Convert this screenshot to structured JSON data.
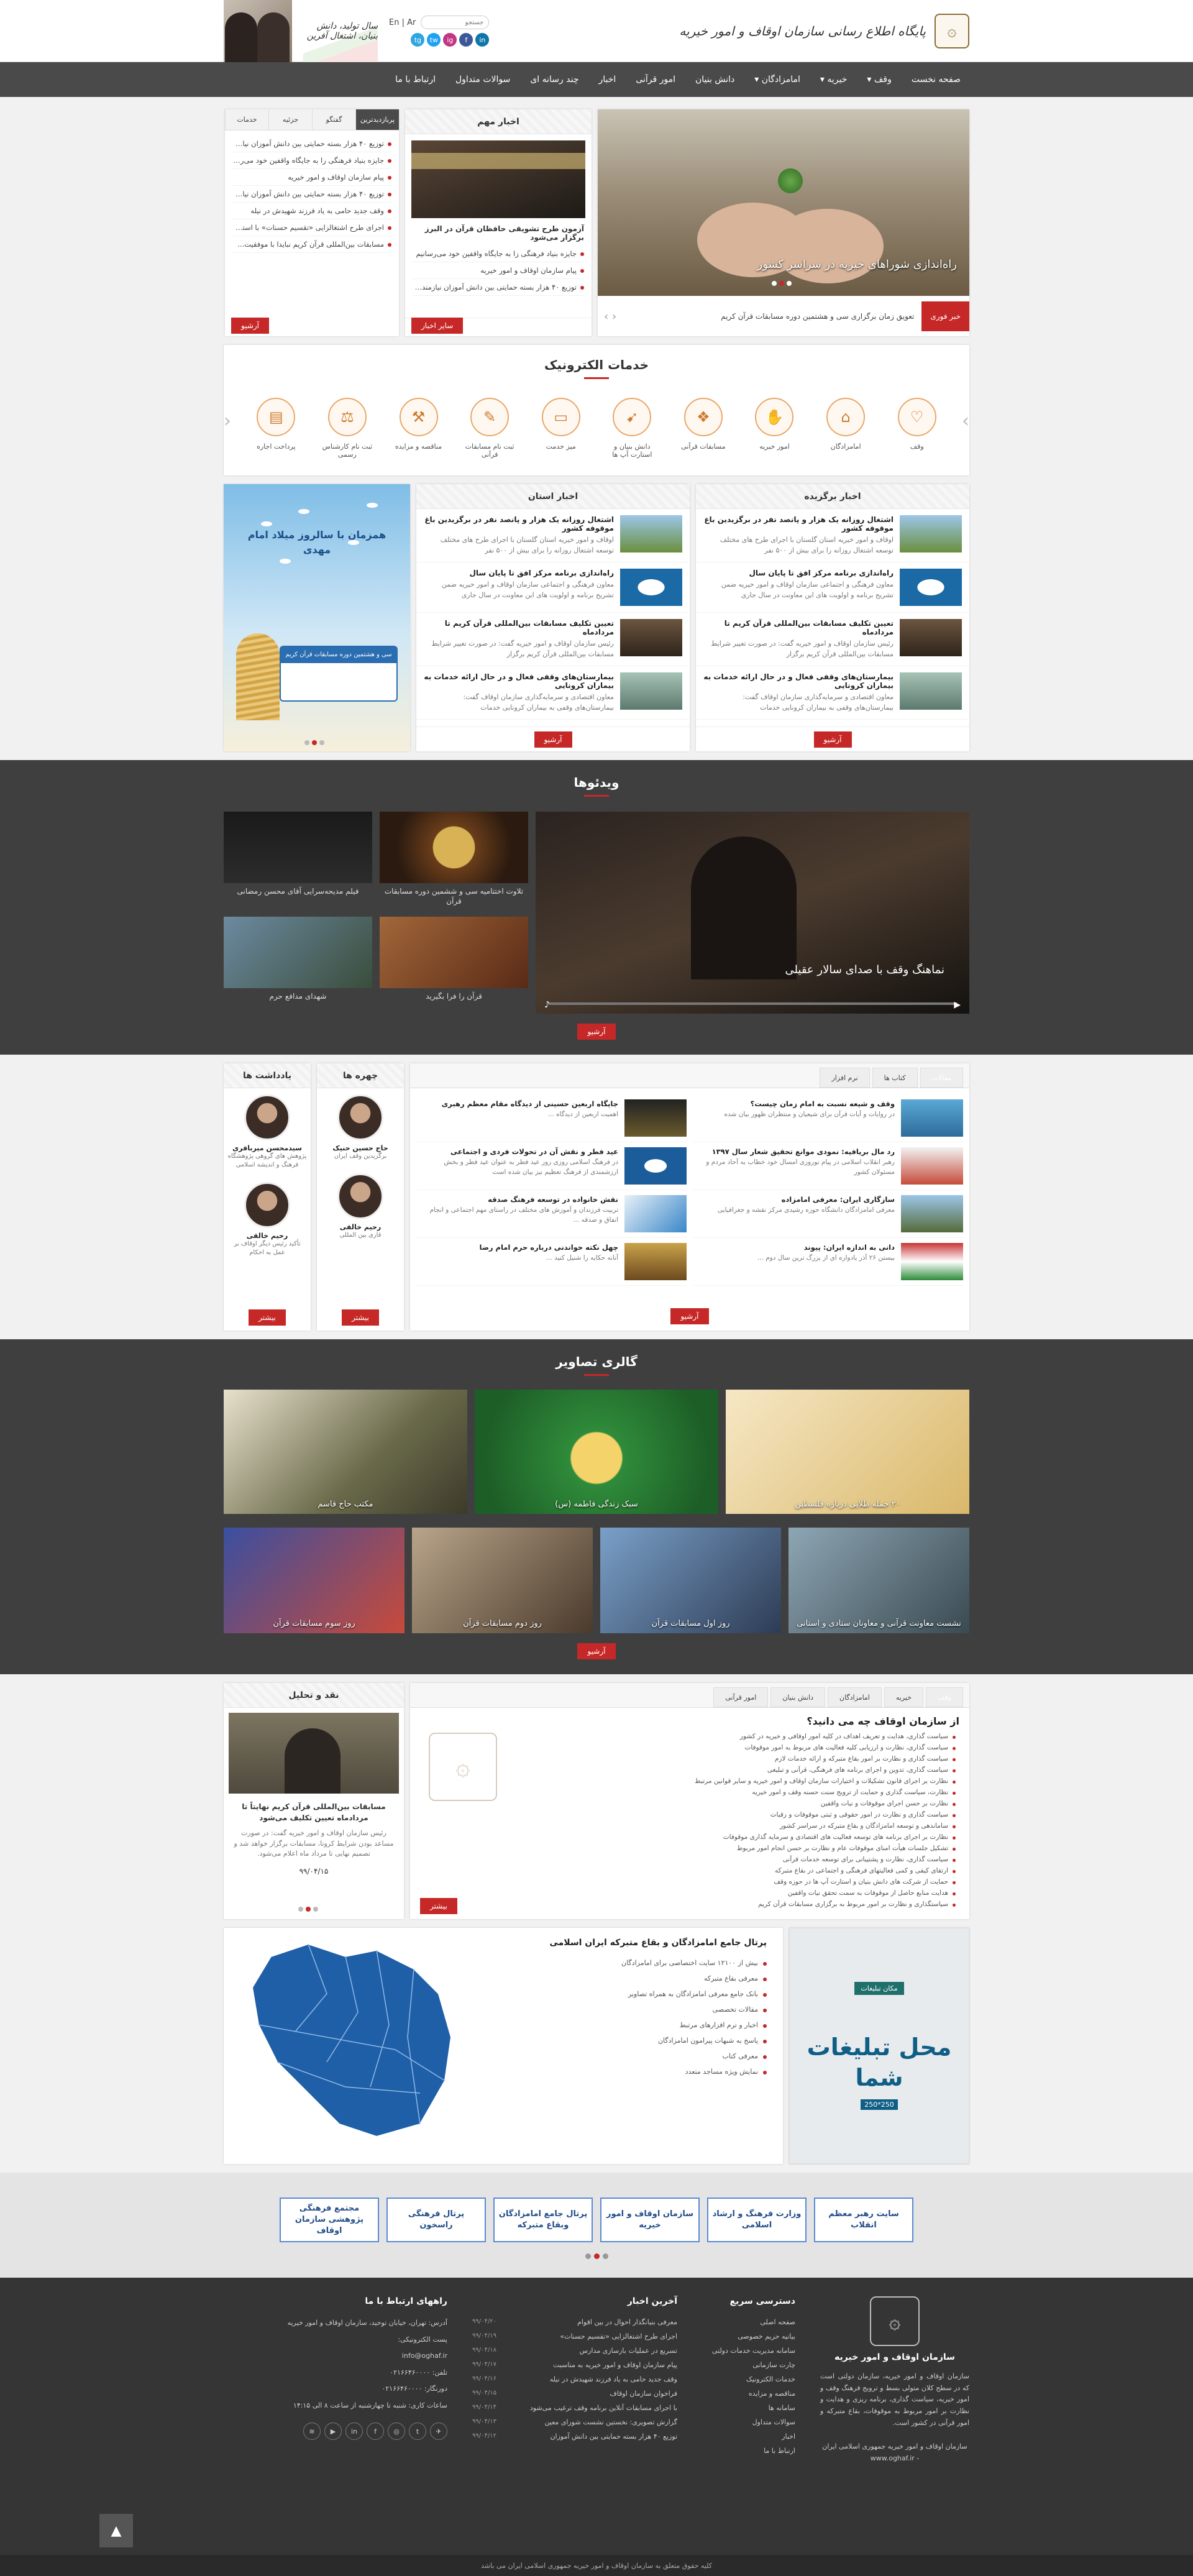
{
  "header": {
    "site_title": "پایگاه اطلاع رسانی سازمان اوقاف و امور خیریه",
    "lang_en": "En",
    "lang_ar": "Ar",
    "search_placeholder": "جستجو",
    "flag_slogan": "سال تولید، دانش بنیان، اشتغال آفرین",
    "socials": [
      "in",
      "f",
      "ig",
      "tw",
      "tg"
    ]
  },
  "nav": [
    "صفحه نخست",
    "وقف",
    "خیریه",
    "امامزادگان",
    "دانش بنیان",
    "امور قرآنی",
    "اخبار",
    "چند رسانه ای",
    "سوالات متداول",
    "ارتباط با ما"
  ],
  "slider": {
    "caption": "راه‌اندازی شوراهای خیریه در سراسر کشور",
    "ticker_label": "خبر فوری",
    "ticker_text": "تعویق زمان برگزاری سی و هشتمین دوره مسابقات قرآن کریم"
  },
  "important_news": {
    "title": "اخبار مهم",
    "lead": "آزمون طرح تشویقی حافظان قرآن در البرز برگزار می‌شود",
    "items": [
      "جایزه بنیاد فرهنگی زا به جایگاه واقفین خود می‌رسانیم",
      "پیام سازمان اوقاف و امور خیریه",
      "توزیع ۴۰ هزار بسته حمایتی بین دانش آموزان نیازمند کشور"
    ],
    "more": "سایر اخبار"
  },
  "tabs_box": {
    "tabs": [
      "پربازدیدترین",
      "گفتگو",
      "جزئیه",
      "خدمات"
    ],
    "items": [
      "توزیع ۴۰ هزار بسته حمایتی بین دانش آموزان نیازمند کشور",
      "جایزه بنیاد فرهنگی زا به جایگاه واقفین خود می‌رسانیم",
      "پیام سازمان اوقاف و امور خیریه",
      "توزیع ۴۰ هزار بسته حمایتی بین دانش آموزان نیازمند کشور",
      "وقف جدید حامی به یاد فرزند شهیدش در نیله",
      "اجرای طرح اشتغالزایی «تقسیم حسنات» با استفاده از ...",
      "مسابقات بین‌المللی قرآن کریم نبایدا با موفقیت..."
    ],
    "archive": "آرشیو"
  },
  "services": {
    "title": "خدمات الکترونیک",
    "items": [
      "وقف",
      "امامزادگان",
      "امور خیریه",
      "مسابقات قرآنی",
      "دانش بنیان و استارت آپ ها",
      "میز خدمت",
      "ثبت نام مسابقات قرآنی",
      "مناقصه و مزایده",
      "ثبت نام کارشناس رسمی",
      "پرداخت اجاره"
    ]
  },
  "selected_news": {
    "title": "اخبار برگزیده",
    "items": [
      {
        "t1": "اشتغال روزانه یک هزار و پانصد نفر در برگزیدین باغ موقوفه کشور",
        "t2": "اوقاف و امور خیریه استان گلستان با اجرای طرح های مختلف توسعه اشتغال روزانه را برای بیش از ۵۰۰ نفر"
      },
      {
        "t1": "راه‌اندازی برنامه مرکز افق تا پایان سال",
        "t2": "معاون فرهنگی و اجتماعی سازمان اوقاف و امور خیریه ضمن تشریح برنامه و اولویت های این معاونت در سال جاری"
      },
      {
        "t1": "تعیین تکلیف مسابقات بین‌المللی قرآن کریم تا مرداد‌ماه",
        "t2": "رئیس سازمان اوقاف و امور خیریه گفت: در صورت تغییر شرایط مسابقات بین‌المللی قرآن کریم برگزار"
      },
      {
        "t1": "بیمارستان‌های وقفی فعال و در حال ارائه خدمات به بیماران کرونایی",
        "t2": "معاون اقتصادی و سرمایه‌گذاری سازمان اوقاف گفت: بیمارستان‌های وقفی به بیماران کرونایی خدمات"
      }
    ],
    "archive": "آرشیو"
  },
  "province_news": {
    "title": "اخبار استان",
    "items": [
      {
        "t1": "اشتغال روزانه یک هزار و پانصد نفر در برگزیدین باغ موقوفه کشور",
        "t2": "اوقاف و امور خیریه استان گلستان با اجرای طرح های مختلف توسعه اشتغال روزانه را برای بیش از ۵۰۰ نفر"
      },
      {
        "t1": "راه‌اندازی برنامه مرکز افق تا پایان سال",
        "t2": "معاون فرهنگی و اجتماعی سازمان اوقاف و امور خیریه ضمن تشریح برنامه و اولویت های این معاونت در سال جاری"
      },
      {
        "t1": "تعیین تکلیف مسابقات بین‌المللی قرآن کریم تا مرداد‌ماه",
        "t2": "رئیس سازمان اوقاف و امور خیریه گفت: در صورت تغییر شرایط مسابقات بین‌المللی قرآن کریم برگزار"
      },
      {
        "t1": "بیمارستان‌های وقفی فعال و در حال ارائه خدمات به بیماران کرونایی",
        "t2": "معاون اقتصادی و سرمایه‌گذاری سازمان اوقاف گفت: بیمارستان‌های وقفی به بیماران کرونایی خدمات"
      }
    ],
    "archive": "آرشیو"
  },
  "poster": {
    "title": "همزمان با سالروز میلاد امام مهدی",
    "subtitle": "سی و هشتمین دوره مسابقات قرآن کریم"
  },
  "videos": {
    "title": "ویدئوها",
    "main_caption": "نماهنگ وقف با صدای سالار عقیلی",
    "items": [
      "تلاوت اختتامیه سی و ششمین دوره مسابقات قرآن",
      "فیلم مدیحه‌سرایی آقای محسن رمضانی",
      "قرآن را فرا بگیرید",
      "شهدای مدافع حرم"
    ],
    "archive": "آرشیو"
  },
  "articles": {
    "tabs": [
      "مقالات",
      "کتاب ها",
      "نرم افزار"
    ],
    "items": [
      {
        "t1": "وقف و شیعه نسبت به امام زمان چیست؟",
        "t2": "در روایات و آیات قرآن برای شیعیان و منتظران ظهور بیان شده"
      },
      {
        "t1": "جایگاه اربعین حسینی از دیدگاه مقام معظم رهبری",
        "t2": "اهمیت اربعین از دیدگاه ..."
      },
      {
        "t1": "رد مال بریافیه: نمودی موانع تحقیق شعار سال ۱۳۹۷",
        "t2": "رهبر انقلاب اسلامی در پیام نوروزی امسال خود خطاب به آحاد مردم و مسئولان کشور"
      },
      {
        "t1": "عید فطر و نقش آن در تحولات فردی و اجتماعی",
        "t2": "در فرهنگ اسلامی روزی روز عید فطر به عنوان عید فطر و بخش ارزشمندی از فرهنگ تعظیم نیز بیان شده است"
      },
      {
        "t1": "سازگاری ایران: معرفی امامزاده",
        "t2": "معرفی امامزادگان دانشگاه حوزه رشیدی مرکز نقشه و جغرافیایی"
      },
      {
        "t1": "نقش خانواده در توسعه فرهنگ صدقه",
        "t2": "تربیت فرزندان و آموزش های مختلف در راستای مهم اجتماعی و انجام انفاق و صدقه ..."
      },
      {
        "t1": "دانی به اندازه ایران: پیوند",
        "t2": "بیستن ۲۶ آذر یادواره ای از بزرگ ترین سال دوم ..."
      },
      {
        "t1": "چهل نکته خواندنی درباره حرم امام رضا",
        "t2": "آنانه حکایه را شنیل کنید ..."
      }
    ],
    "archive": "آرشیو"
  },
  "faces": {
    "title": "چهره ها",
    "items": [
      {
        "name": "حاج حسین حنیک",
        "role": "برگزیدین وقف ایران"
      },
      {
        "name": "رحیم خالقی",
        "role": "قاری بین المللی"
      }
    ],
    "more": "بیشتر"
  },
  "notes": {
    "title": "یادداشت ها",
    "items": [
      {
        "name": "سیدمحسن میرباقری",
        "role": "پژوهش های گروهی پژوهشگاه فرهنگ و اندیشه اسلامی"
      },
      {
        "name": "رحیم خالقی",
        "role": "تأکید رئیس دیگر اوقاف بر عمل به احکام"
      }
    ],
    "more": "بیشتر"
  },
  "gallery": {
    "title": "گالری تصاویر",
    "row1": [
      "۲۰ جمله طلایی درباره فلسطین",
      "سبک زندگی فاطمه (س)",
      "مکتب حاج قاسم"
    ],
    "row2": [
      "نشست معاونت قرآنی و معاونان ستادی و استانی",
      "روز اول مسابقات قرآن",
      "روز دوم مسابقات قرآن",
      "روز سوم مسابقات قرآن"
    ],
    "archive": "آرشیو"
  },
  "about": {
    "tabs": [
      "وقف",
      "خیریه",
      "امامزادگان",
      "دانش بنیان",
      "امور قرآنی"
    ],
    "title": "از سازمان اوقاف چه می دانید؟",
    "items": [
      "سیاست گذاری، هدایت و تعریف اهداف در کلیه امور اوقافی و خیریه در کشور",
      "سیاست گذاری، نظارت و ارزیابی کلیه فعالیت های مربوط به امور موقوفات",
      "سیاست گذاری و نظارت بر امور بقاع متبرکه و ارائه خدمات لازم",
      "سیاست گذاری، تدوین و اجرای برنامه های فرهنگی، قرآنی و تبلیغی",
      "نظارت بر اجرای قانون تشکیلات و اختیارات سازمان اوقاف و امور خیریه و سایر قوانین مرتبط",
      "نظارت، سیاست گذاری و حمایت از ترویج سنت حسنه وقف و امور خیریه",
      "نظارت بر حسن اجرای موقوفات و نیات واقفین",
      "سیاست گذاری و نظارت در امور حقوقی و ثبتی موقوفات و رقبات",
      "ساماندهی و توسعه امامزادگان و بقاع متبرکه در سراسر کشور",
      "نظارت بر اجرای برنامه های توسعه فعالیت های اقتصادی و سرمایه گذاری موقوفات",
      "تشکیل جلسات هیأت امنای موقوفات عام و نظارت بر حسن انجام امور مربوط",
      "سیاست گذاری، نظارت و پشتیبانی برای توسعه خدمات قرآنی",
      "ارتقای کیفی و کمی فعالیتهای فرهنگی و اجتماعی در بقاع متبرکه",
      "حمایت از شرکت های دانش بنیان و استارت آپ ها در حوزه وقف",
      "هدایت منابع حاصل از موقوفات به سمت تحقق نیات واقفین",
      "سیاستگذاری و نظارت بر امور مربوط به برگزاری مسابقات قرآن کریم"
    ],
    "more": "بیشتر"
  },
  "analysis": {
    "title": "نقد و تحلیل",
    "headline": "مسابقات بین‌المللی قرآن کریم نهایتاً تا مرداد‌ماه تعیین تکلیف می‌شود",
    "summary": "رئیس سازمان اوقاف و امور خیریه گفت: در صورت مساعد بودن شرایط کرونا، مسابقات برگزار خواهد شد و تصمیم نهایی تا مرداد ماه اعلام می‌شود.",
    "date": "۹۹/۰۴/۱۵"
  },
  "portal": {
    "title": "پرتال جامع امامزادگان و بقاع متبرکه ایران اسلامی",
    "items": [
      "بیش از ۱۲۱۰۰ سایت اختصاصی برای امامزادگان",
      "معرفی بقاع متبرکه",
      "بانک جامع معرفی امامزادگان به همراه تصاویر",
      "مقالات تخصصی",
      "اخبار و ترم افزارهای مرتبط",
      "پاسخ به شبهات پیرامون امامزادگان",
      "معرفی کتاب",
      "نمایش ویژه مساجد متعدد"
    ]
  },
  "ad": {
    "badge": "مکان تبلیغات",
    "text": "محل تبلیغات شما",
    "size": "250*250"
  },
  "links": [
    "سایت رهبر معظم انقلاب",
    "وزارت فرهنگ و ارشاد اسلامی",
    "سازمان اوقاف و امور خیریه",
    "پرتال جامع امامزادگان وبقاع متبرکه",
    "پرتال فرهنگی راسخون",
    "مجتمع فرهنگی پژوهشی سازمان اوقاف"
  ],
  "footer": {
    "about_title": "سازمان اوقاف و امور خیریه",
    "about_text": "سازمان اوقاف و امور خیریه، سازمان دولتی است که در سطح کلان متولی بسط و ترویج فرهنگ وقف و امور خیریه، سیاست گذاری، برنامه ریزی و هدایت و نظارت بر امور مربوط به موقوفات، بقاع متبرکه و امور قرآنی در کشور است.",
    "about_footer": "سازمان اوقاف و امور خیریه جمهوری اسلامی ایران - www.oghaf.ir",
    "quick_title": "دسترسی سریع",
    "quick": [
      "صفحه اصلی",
      "بیانیه حریم خصوصی",
      "سامانه مدیریت خدمات دولتی",
      "چارت سازمانی",
      "خدمات الکترونیک",
      "مناقصه و مزایده",
      "سامانه ها",
      "سوالات متداول",
      "اخبار",
      "ارتباط با ما"
    ],
    "latest_title": "آخرین اخبار",
    "latest": [
      {
        "t": "معرفی بنیانگذار احوال در بین اقوام",
        "d": "۹۹/۰۴/۲۰"
      },
      {
        "t": "اجرای طرح اشتغالزایی «تقسیم حسنات»",
        "d": "۹۹/۰۴/۱۹"
      },
      {
        "t": "تسریع در عملیات بازسازی مدارس",
        "d": "۹۹/۰۴/۱۸"
      },
      {
        "t": "پیام سازمان اوقاف و امور خیریه به مناسبت",
        "d": "۹۹/۰۴/۱۷"
      },
      {
        "t": "وقف جدید حامی به یاد فرزند شهیدش در نیله",
        "d": "۹۹/۰۴/۱۶"
      },
      {
        "t": "فراخوان سازمان اوقاف",
        "d": "۹۹/۰۴/۱۵"
      },
      {
        "t": "با اجرای مسابقات آنلاین برنامه وقف ترغیب می‌شود",
        "d": "۹۹/۰۴/۱۴"
      },
      {
        "t": "گزارش تصویری: نخستین نشست شورای معین",
        "d": "۹۹/۰۴/۱۳"
      },
      {
        "t": "توزیع ۴۰ هزار بسته حمایتی بین دانش آموزان",
        "d": "۹۹/۰۴/۱۲"
      }
    ],
    "contact_title": "راههای ارتباط با ما",
    "contact": [
      "آدرس: تهران، خیابان توحید، سازمان اوقاف و امور خیریه",
      "پست الکترونیکی:",
      "info@oghaf.ir",
      "تلفن: ۰۲۱۶۶۴۶۰۰۰۰",
      "دورنگار: ۰۲۱۶۶۴۶۰۰۰۰",
      "ساعات کاری: شنبه تا چهارشنبه از ساعت ۸ الی ۱۴:۱۵"
    ],
    "copyright": "کلیه حقوق متعلق به سازمان اوقاف و امور خیریه جمهوری اسلامی ایران می باشد",
    "to_top": "▲"
  },
  "colors": {
    "accent": "#c62828",
    "nav": "#4a4a4a",
    "dark": "#3f3f3f",
    "footer": "#353535",
    "link_border": "#5a8ad3"
  }
}
